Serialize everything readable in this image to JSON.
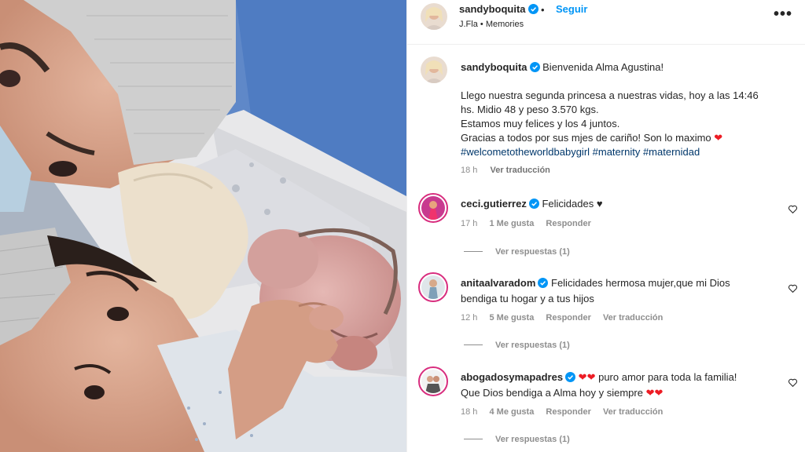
{
  "post": {
    "username": "sandyboquita",
    "dot": "•",
    "follow_label": "Seguir",
    "audio_artist": "J.Fla",
    "audio_sep": "•",
    "audio_title": "Memories",
    "more_label": "•••"
  },
  "caption": {
    "username": "sandyboquita",
    "line1": "Bienvenida Alma Agustina!",
    "line2": "Llego nuestra segunda princesa a nuestras vidas, hoy a las 14:46",
    "line3": "hs. Midio 48 y peso 3.570 kgs.",
    "line4": "Estamos muy felices y los 4 juntos.",
    "line5": "Gracias a todos por sus mjes de cariño! Son lo maximo",
    "hashtags": "#welcometotheworldbabygirl #maternity #maternidad",
    "time": "18 h",
    "translate": "Ver traducción"
  },
  "comments": [
    {
      "username": "ceci.gutierrez",
      "text": "Felicidades",
      "time": "17 h",
      "likes": "1 Me gusta",
      "reply": "Responder",
      "translate": "",
      "replies": "Ver respuestas (1)"
    },
    {
      "username": "anitaalvaradom",
      "text": "Felicidades hermosa mujer,que mi Dios",
      "text2": "bendiga tu hogar y a tus hijos",
      "time": "12 h",
      "likes": "5 Me gusta",
      "reply": "Responder",
      "translate": "Ver traducción",
      "replies": "Ver respuestas (1)"
    },
    {
      "username": "abogadosymapadres",
      "text": "puro amor para toda la familia!",
      "text2": "Que Dios bendiga a Alma hoy y siempre",
      "time": "18 h",
      "likes": "4 Me gusta",
      "reply": "Responder",
      "translate": "Ver traducción",
      "replies": "Ver respuestas (1)"
    }
  ],
  "colors": {
    "link": "#0095f6",
    "hashtag": "#00376b",
    "heart": "#ed1c24",
    "meta": "#8e8e8e"
  }
}
